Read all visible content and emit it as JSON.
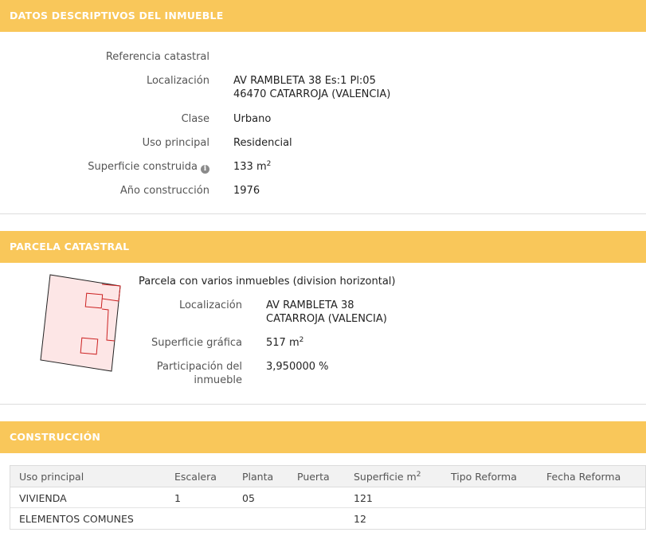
{
  "section1": {
    "title": "DATOS DESCRIPTIVOS DEL INMUEBLE",
    "fields": {
      "referencia": {
        "label": "Referencia catastral",
        "value": ""
      },
      "localizacion": {
        "label": "Localización",
        "value_line1": "AV RAMBLETA 38 Es:1 Pl:05",
        "value_line2": "46470 CATARROJA (VALENCIA)"
      },
      "clase": {
        "label": "Clase",
        "value": "Urbano"
      },
      "uso": {
        "label": "Uso principal",
        "value": "Residencial"
      },
      "superficie": {
        "label": "Superficie construida",
        "value": "133 m",
        "unit_sup": "2",
        "info_icon": "info-icon"
      },
      "anio": {
        "label": "Año construcción",
        "value": "1976"
      }
    }
  },
  "section2": {
    "title": "PARCELA CATASTRAL",
    "description": "Parcela con varios inmuebles (division horizontal)",
    "fields": {
      "localizacion": {
        "label": "Localización",
        "value_line1": "AV RAMBLETA 38",
        "value_line2": "CATARROJA (VALENCIA)"
      },
      "superficie": {
        "label": "Superficie gráfica",
        "value": "517 m",
        "unit_sup": "2"
      },
      "participacion": {
        "label_line1": "Participación del",
        "label_line2": "inmueble",
        "value": "3,950000 %"
      }
    },
    "map_colors": {
      "fill": "#fde6e6",
      "outline": "#222222",
      "unit": "#cc2222"
    }
  },
  "section3": {
    "title": "CONSTRUCCIÓN",
    "columns": [
      "Uso principal",
      "Escalera",
      "Planta",
      "Puerta",
      "Superficie m",
      "Tipo Reforma",
      "Fecha Reforma"
    ],
    "superficie_sup": "2",
    "rows": [
      [
        "VIVIENDA",
        "1",
        "05",
        "",
        "121",
        "",
        ""
      ],
      [
        "ELEMENTOS COMUNES",
        "",
        "",
        "",
        "12",
        "",
        ""
      ]
    ]
  },
  "colors": {
    "header_bg": "#f9c75a",
    "header_text": "#ffffff"
  }
}
